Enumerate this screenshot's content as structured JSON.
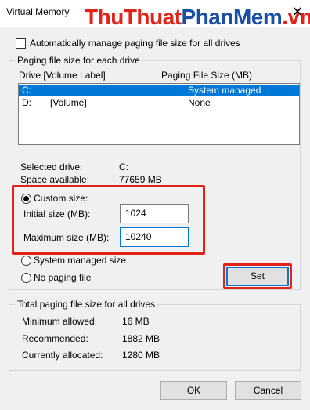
{
  "window": {
    "title": "Virtual Memory",
    "watermark_part1": "Thu",
    "watermark_part2": "Thuat",
    "watermark_part3": "PhanMem",
    "watermark_part4": ".vn",
    "close_glyph": "✕"
  },
  "auto_manage": {
    "label": "Automatically manage paging file size for all drives",
    "checked": false
  },
  "paging_group": {
    "legend": "Paging file size for each drive",
    "col_drive": "Drive  [Volume Label]",
    "col_size": "Paging File Size (MB)",
    "rows": [
      {
        "drive": "C:",
        "label": "",
        "size": "System managed",
        "selected": true
      },
      {
        "drive": "D:",
        "label": "[Volume]",
        "size": "None",
        "selected": false
      }
    ],
    "selected_drive_label": "Selected drive:",
    "selected_drive_value": "C:",
    "space_label": "Space available:",
    "space_value": "77659 MB"
  },
  "size_options": {
    "custom_label": "Custom size:",
    "initial_label": "Initial size (MB):",
    "initial_value": "1024",
    "maximum_label": "Maximum size (MB):",
    "maximum_value": "10240",
    "system_managed_label": "System managed size",
    "no_paging_label": "No paging file",
    "selected": "custom",
    "set_button": "Set"
  },
  "total_group": {
    "legend": "Total paging file size for all drives",
    "min_label": "Minimum allowed:",
    "min_value": "16 MB",
    "rec_label": "Recommended:",
    "rec_value": "1882 MB",
    "cur_label": "Currently allocated:",
    "cur_value": "1280 MB"
  },
  "footer": {
    "ok_label": "OK",
    "cancel_label": "Cancel"
  },
  "colors": {
    "selection": "#0078d7",
    "highlight_box": "#e2231a",
    "watermark_blue": "#1a4fa3"
  }
}
